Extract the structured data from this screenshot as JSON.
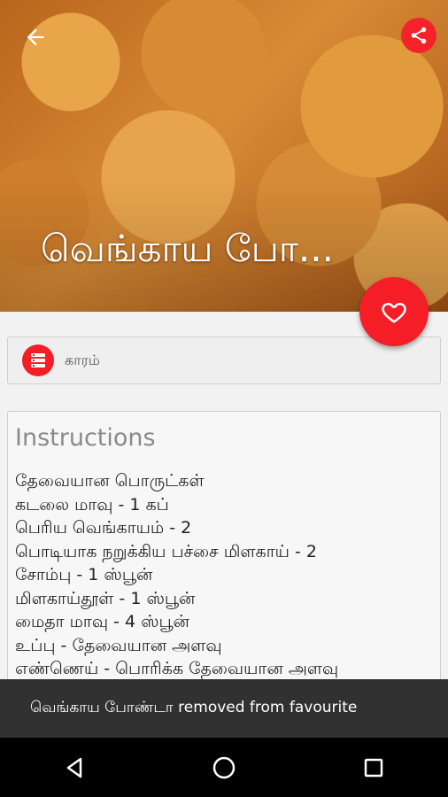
{
  "hero": {
    "title": "வெங்காய போ..."
  },
  "category": {
    "label": "காரம்"
  },
  "instructions": {
    "heading": "Instructions",
    "lines": [
      "தேவையான பொருட்கள்",
      "கடலை மாவு  -  1  கப்",
      "பெரிய வெங்காயம்  - 2",
      "பொடியாக நறுக்கிய பச்சை மிளகாய் - 2",
      "சோம்பு  -  1  ஸ்பூன்",
      "மிளகாய்தூள்  - 1  ஸ்பூன்",
      "மைதா மாவு  -  4 ஸ்பூன்",
      "உப்பு  -  தேவையான அளவு",
      "எண்ணெய்  - பொரிக்க தேவையான அளவு"
    ]
  },
  "snackbar": {
    "message": "வெங்காய போண்டா  removed from favourite"
  },
  "colors": {
    "accent": "#f51d26",
    "snackbar": "#313131"
  }
}
